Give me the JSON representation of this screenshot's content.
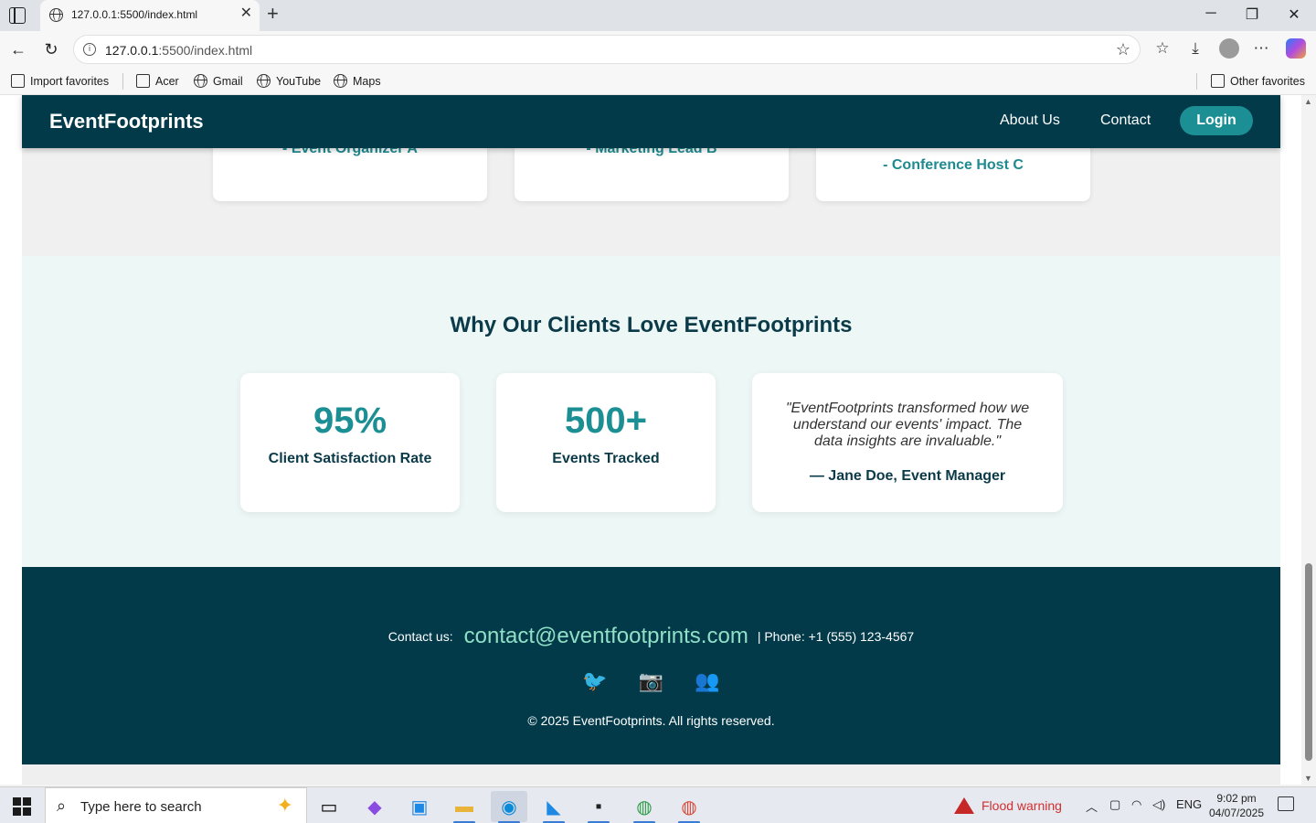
{
  "browser": {
    "tab_title": "127.0.0.1:5500/index.html",
    "url_host": "127.0.0.1",
    "url_rest": ":5500/index.html",
    "favorites": [
      {
        "label": "Import favorites",
        "icon": "import-icon"
      },
      {
        "label": "Acer",
        "icon": "folder-icon"
      },
      {
        "label": "Gmail",
        "icon": "globe-icon"
      },
      {
        "label": "YouTube",
        "icon": "globe-icon"
      },
      {
        "label": "Maps",
        "icon": "globe-icon"
      }
    ],
    "other_favorites": "Other favorites"
  },
  "navbar": {
    "brand": "EventFootprints",
    "links": [
      "About Us",
      "Contact"
    ],
    "login": "Login"
  },
  "testimonials": {
    "authors": [
      "- Event Organizer A",
      "- Marketing Lead B",
      "- Conference Host C"
    ]
  },
  "why": {
    "title": "Why Our Clients Love EventFootprints",
    "stats": [
      {
        "value": "95%",
        "label": "Client Satisfaction Rate"
      },
      {
        "value": "500+",
        "label": "Events Tracked"
      }
    ],
    "quote": "\"EventFootprints transformed how we understand our events' impact. The data insights are invaluable.\"",
    "quote_author": "— Jane Doe, Event Manager"
  },
  "footer": {
    "contact_prefix": "Contact us:",
    "email": "contact@eventfootprints.com",
    "phone": "| Phone: +1 (555) 123-4567",
    "socials": [
      "🐦",
      "📷",
      "👥"
    ],
    "copyright": "© 2025 EventFootprints. All rights reserved."
  },
  "taskbar": {
    "search_placeholder": "Type here to search",
    "weather_alert": "Flood warning",
    "language": "ENG",
    "time": "9:02 pm",
    "date": "04/07/2025"
  },
  "colors": {
    "primary_dark": "#023a4a",
    "accent": "#1b8f94",
    "email": "#8fe0c6",
    "section_bg": "#edf7f6"
  }
}
